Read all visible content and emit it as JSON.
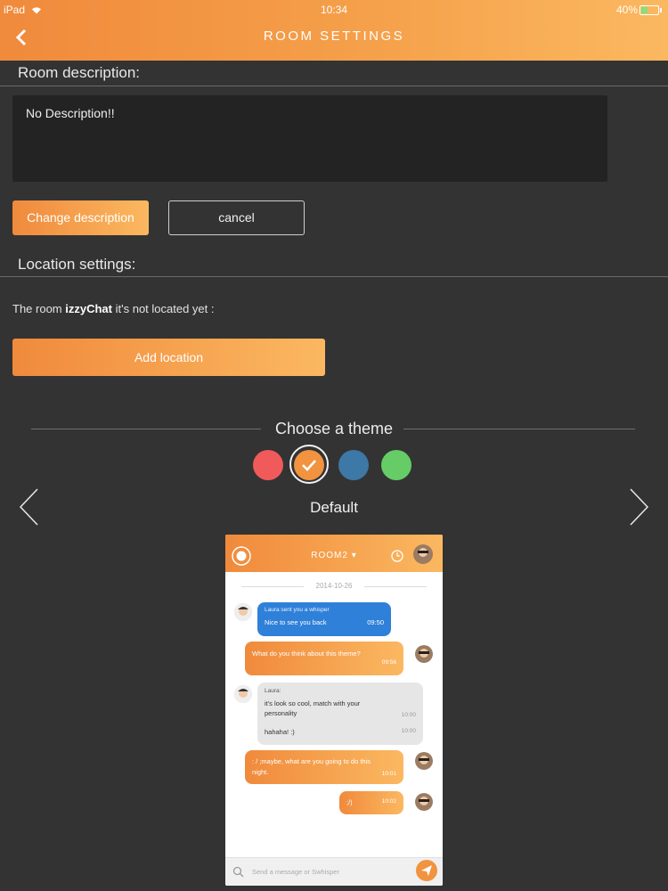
{
  "status_bar": {
    "device": "iPad",
    "time": "10:34",
    "battery": "40%",
    "battery_level": 0.4
  },
  "header": {
    "title": "ROOM SETTINGS"
  },
  "description_section": {
    "title": "Room description:",
    "value": "No Description!!",
    "change_label": "Change description",
    "cancel_label": "cancel"
  },
  "location_section": {
    "title": "Location settings:",
    "text_prefix": "The room",
    "room_name": "izzyChat",
    "text_suffix": "it's not located yet :",
    "add_label": "Add location"
  },
  "theme_section": {
    "title": "Choose a theme",
    "selected_name": "Default",
    "swatches": [
      {
        "color": "#f05a5a",
        "selected": false
      },
      {
        "color": "#f29340",
        "selected": true
      },
      {
        "color": "#3d78a6",
        "selected": false
      },
      {
        "color": "#66cc66",
        "selected": false
      }
    ]
  },
  "preview": {
    "room": "ROOM2 ▾",
    "date": "2014-10-26",
    "messages": [
      {
        "title": "Laura sent you a whisper",
        "text": "Nice to see you back",
        "time": "09:50"
      },
      {
        "text": "What do you think about this theme?",
        "time": "09:56"
      },
      {
        "title": "Laura:",
        "text": "it's look so cool, match with your personality",
        "time": "10:00",
        "text2": "hahaha! :)",
        "time2": "10:00"
      },
      {
        "text": ": / ;maybe, what are you going to do this night.",
        "time": "10:01"
      },
      {
        "text": ";/)",
        "time": "10:02"
      }
    ],
    "input_placeholder": "Send a message or Swhisper"
  }
}
